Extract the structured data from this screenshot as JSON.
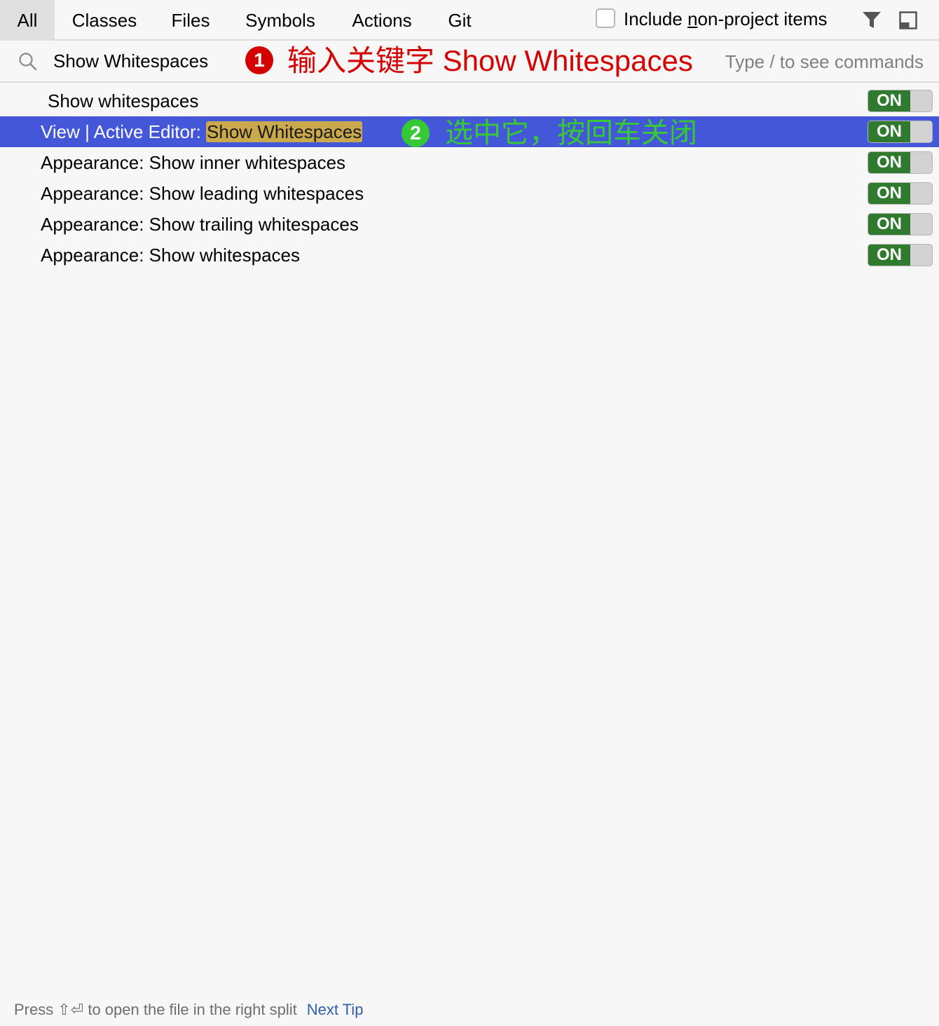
{
  "tabs": [
    {
      "label": "All",
      "active": true
    },
    {
      "label": "Classes"
    },
    {
      "label": "Files"
    },
    {
      "label": "Symbols"
    },
    {
      "label": "Actions"
    },
    {
      "label": "Git"
    }
  ],
  "include_option": {
    "label_before": "Include ",
    "label_mnemonic": "n",
    "label_after": "on-project items",
    "checked": false
  },
  "toolbar_icons": [
    "filter-icon",
    "panel-icon"
  ],
  "search": {
    "value": "Show Whitespaces",
    "hint": "Type / to see commands"
  },
  "annotations": {
    "step1_number": "1",
    "step1_text": "输入关键字 Show Whitespaces",
    "step1_color": "#d40000",
    "step2_number": "2",
    "step2_text": "选中它，按回车关闭",
    "step2_color": "#37c837"
  },
  "results": [
    {
      "label": "Show whitespaces",
      "toggle": "ON"
    },
    {
      "label_prefix": "View | Active Editor: ",
      "label_highlight": "Show Whitespaces",
      "toggle": "ON",
      "selected": true
    },
    {
      "label": "Appearance: Show inner whitespaces",
      "toggle": "ON"
    },
    {
      "label": "Appearance: Show leading whitespaces",
      "toggle": "ON"
    },
    {
      "label": "Appearance: Show trailing whitespaces",
      "toggle": "ON"
    },
    {
      "label": "Appearance: Show whitespaces",
      "toggle": "ON"
    }
  ],
  "footer": {
    "tip": "Press ⇧⏎ to open the file in the right split",
    "next_tip": "Next Tip"
  },
  "colors": {
    "selection": "#4457d8",
    "highlight": "#c9a94c",
    "toggle_on": "#2f7a2f",
    "link": "#2f5fa8"
  }
}
